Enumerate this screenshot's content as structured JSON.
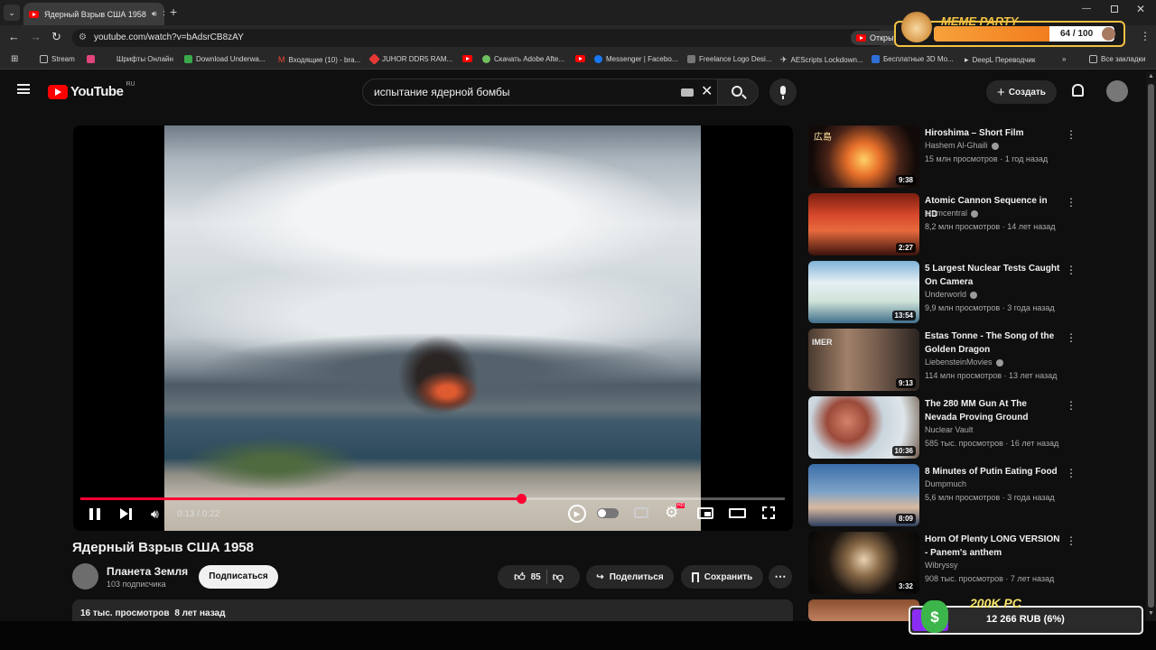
{
  "browser": {
    "tab_title": "Ядерный Взрыв США 1958",
    "url": "youtube.com/watch?v=bAdsrCB8zAY",
    "open_in_app_label": "Открыт",
    "bookmarks": [
      "Stream",
      "Шрифты Онлайн",
      "Download Underwa...",
      "Входящие (10) - bra...",
      "JUHOR DDR5 RAM...",
      "Скачать Adobe Afte...",
      "Messenger | Facebo...",
      "Freelance Logo Desi...",
      "AEScripts Lockdown...",
      "Бесплатные 3D Mo...",
      "DeepL Переводчик"
    ],
    "all_bookmarks": "Все закладки"
  },
  "youtube": {
    "logo_text": "YouTube",
    "region": "RU",
    "search_query": "испытание ядерной бомбы",
    "create_label": "Создать"
  },
  "player": {
    "time": "0:13 / 0:22",
    "progress": 0.625,
    "settings_badge": "HD"
  },
  "video": {
    "title": "Ядерный Взрыв США 1958",
    "channel": "Планета Земля",
    "subscribers": "103 подписчика",
    "subscribe_label": "Подписаться",
    "likes": "85",
    "share_label": "Поделиться",
    "save_label": "Сохранить",
    "views": "16 тыс. просмотров",
    "age": "8 лет назад"
  },
  "recommendations": [
    {
      "title": "Hiroshima – Short Film",
      "channel": "Hashem Al-Ghaili",
      "verified": true,
      "meta": "15 млн просмотров · 1 год назад",
      "duration": "9:38",
      "thumb_text": "広島"
    },
    {
      "title": "Atomic Cannon Sequence in HD",
      "channel": "atomcentral",
      "verified": true,
      "meta": "8,2 млн просмотров · 14 лет назад",
      "duration": "2:27"
    },
    {
      "title": "5 Largest Nuclear Tests Caught On Camera",
      "channel": "Underworld",
      "verified": true,
      "meta": "9,9 млн просмотров · 3 года назад",
      "duration": "13:54"
    },
    {
      "title": "Estas Tonne - The Song of the Golden Dragon",
      "channel": "LiebensteinMovies",
      "verified": true,
      "meta": "114 млн просмотров · 13 лет назад",
      "duration": "9:13",
      "thumb_text": "IMER"
    },
    {
      "title": "The 280 MM Gun At The Nevada Proving Ground",
      "channel": "Nuclear Vault",
      "verified": false,
      "meta": "585 тыс. просмотров · 16 лет назад",
      "duration": "10:36"
    },
    {
      "title": "8 Minutes of Putin Eating Food",
      "channel": "Dumpmuch",
      "verified": false,
      "meta": "5,6 млн просмотров · 3 года назад",
      "duration": "8:09"
    },
    {
      "title": "Horn Of Plenty LONG VERSION - Panem's anthem",
      "channel": "Wibryssy",
      "verified": false,
      "meta": "908 тыс. просмотров · 7 лет назад",
      "duration": "3:32"
    }
  ],
  "overlays": {
    "meme_title": "MEME PARTY",
    "meme_count": "64 / 100",
    "meme_progress": 0.64,
    "money_title": "200K PC",
    "money_value": "12 266 RUB (6%)",
    "money_progress": 0.06
  },
  "colors": {
    "accent": "#ff0033",
    "background": "#0f0f0f",
    "meme_gold": "#f3c242",
    "money_purple": "#8b2cf5"
  }
}
